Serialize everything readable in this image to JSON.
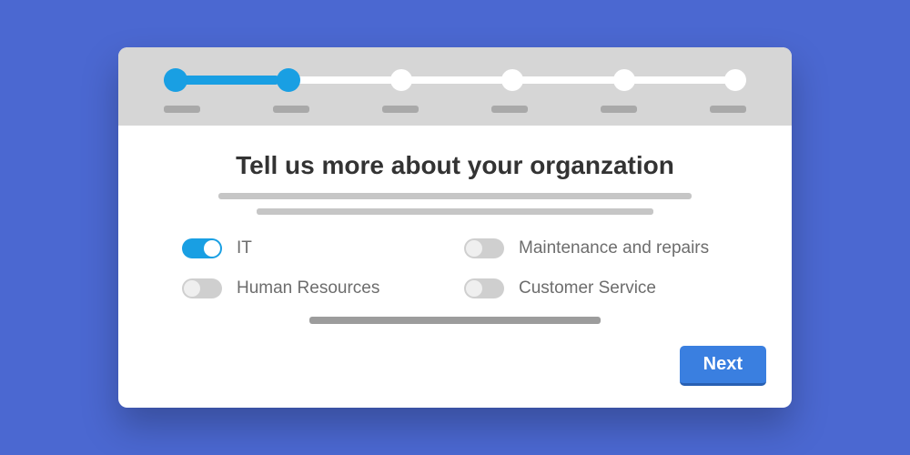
{
  "stepper": {
    "total_steps": 6,
    "current_step": 2
  },
  "heading": "Tell us more about your organzation",
  "options": [
    {
      "key": "it",
      "label": "IT",
      "enabled": true
    },
    {
      "key": "maintenance",
      "label": "Maintenance and repairs",
      "enabled": false
    },
    {
      "key": "hr",
      "label": "Human Resources",
      "enabled": false
    },
    {
      "key": "customer_service",
      "label": "Customer Service",
      "enabled": false
    }
  ],
  "footer": {
    "next_label": "Next"
  }
}
